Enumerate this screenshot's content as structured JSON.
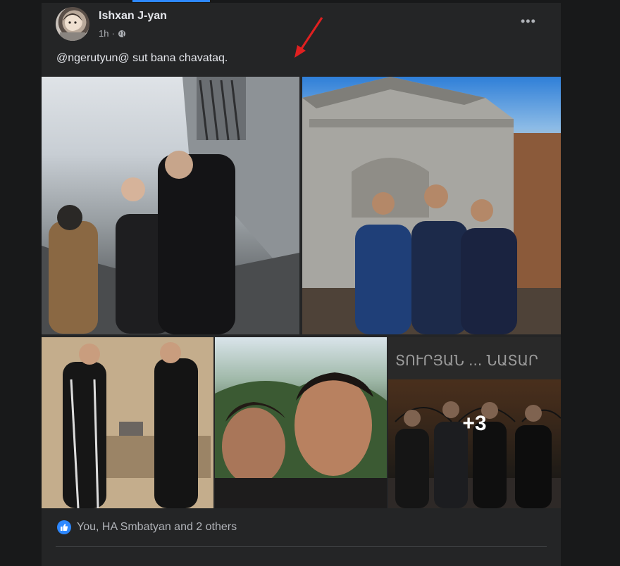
{
  "post": {
    "author": "Ishxan J-yan",
    "time": "1h",
    "caption": "@ngerutyun@ sut bana chavataq.",
    "more_icon": "more-horizontal-icon",
    "privacy_icon": "globe-icon"
  },
  "photos": {
    "overflow_label": "+3"
  },
  "reactions": {
    "text": "You, HA Smbatyan and 2 others",
    "icon": "like-icon"
  },
  "colors": {
    "background": "#18191a",
    "card": "#242526",
    "accent": "#2d88ff",
    "annotation_arrow": "#e02020"
  }
}
